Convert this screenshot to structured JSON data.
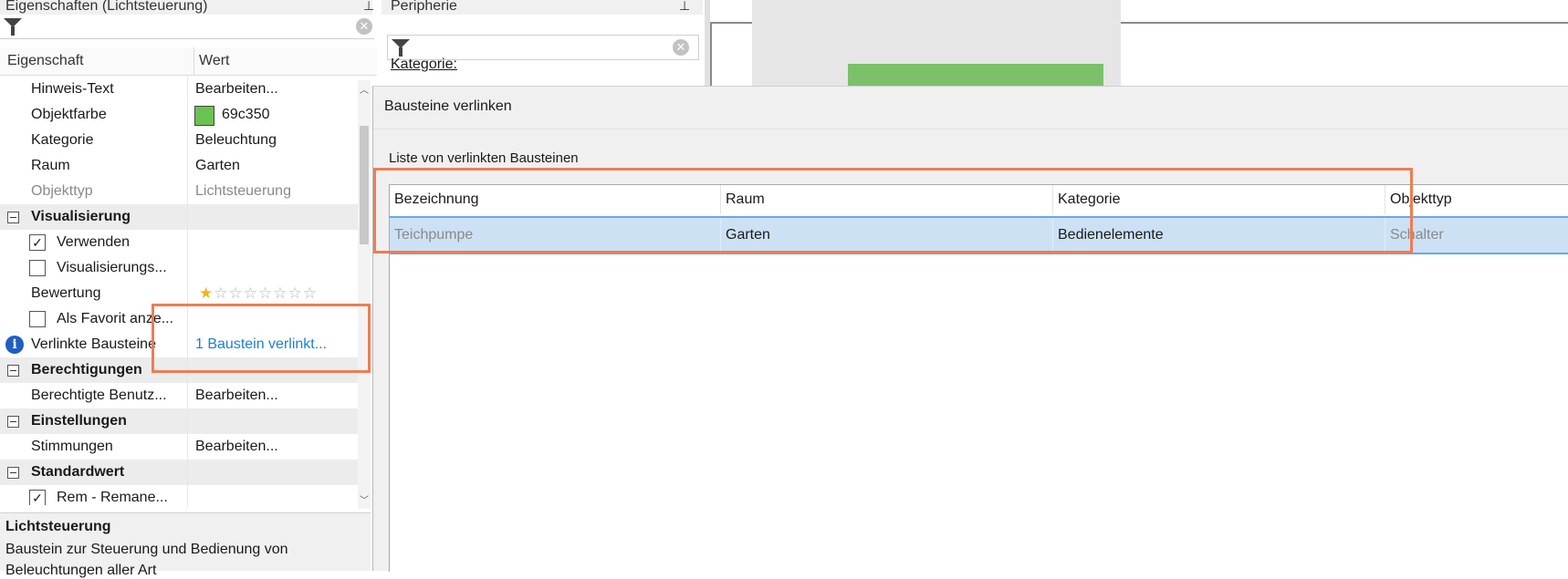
{
  "props_panel": {
    "title": "Eigenschaften (Lichtsteuerung)",
    "col_property": "Eigenschaft",
    "col_value": "Wert",
    "rows": [
      {
        "name": "Hinweis-Text",
        "value": "Bearbeiten..."
      },
      {
        "name": "Objektfarbe",
        "value": "69c350"
      },
      {
        "name": "Kategorie",
        "value": "Beleuchtung"
      },
      {
        "name": "Raum",
        "value": "Garten"
      },
      {
        "name": "Objekttyp",
        "value": "Lichtsteuerung"
      },
      {
        "group": "Visualisierung"
      },
      {
        "name": "Verwenden",
        "checked": true
      },
      {
        "name": "Visualisierungs...",
        "checked": false
      },
      {
        "name": "Bewertung",
        "rating": 1,
        "rating_max": 8
      },
      {
        "name": "Als Favorit anze...",
        "checked": false
      },
      {
        "name": "Verlinkte Bausteine",
        "value": "1 Baustein verlinkt..."
      },
      {
        "group": "Berechtigungen"
      },
      {
        "name": "Berechtigte Benutz...",
        "value": "Bearbeiten..."
      },
      {
        "group": "Einstellungen"
      },
      {
        "name": "Stimmungen",
        "value": "Bearbeiten..."
      },
      {
        "group": "Standardwert"
      },
      {
        "name": "Rem - Remane...",
        "checked": true
      }
    ],
    "color_swatch": "#69c350",
    "description_title": "Lichtsteuerung",
    "description_text": "Baustein zur Steuerung und Bedienung von",
    "description_text2": "Beleuchtungen aller Art"
  },
  "periph_panel": {
    "title": "Peripherie",
    "category_label": "Kategorie:"
  },
  "dialog": {
    "title": "Bausteine verlinken",
    "section_label": "Liste von verlinkten Bausteinen",
    "columns": [
      "Bezeichnung",
      "Raum",
      "Kategorie",
      "Objekttyp"
    ],
    "rows": [
      [
        "Teichpumpe",
        "Garten",
        "Bedienelemente",
        "Schalter"
      ]
    ]
  },
  "colors": {
    "highlight": "#ef7c55",
    "selection": "#cde1f5",
    "link": "#1e7ed8"
  }
}
